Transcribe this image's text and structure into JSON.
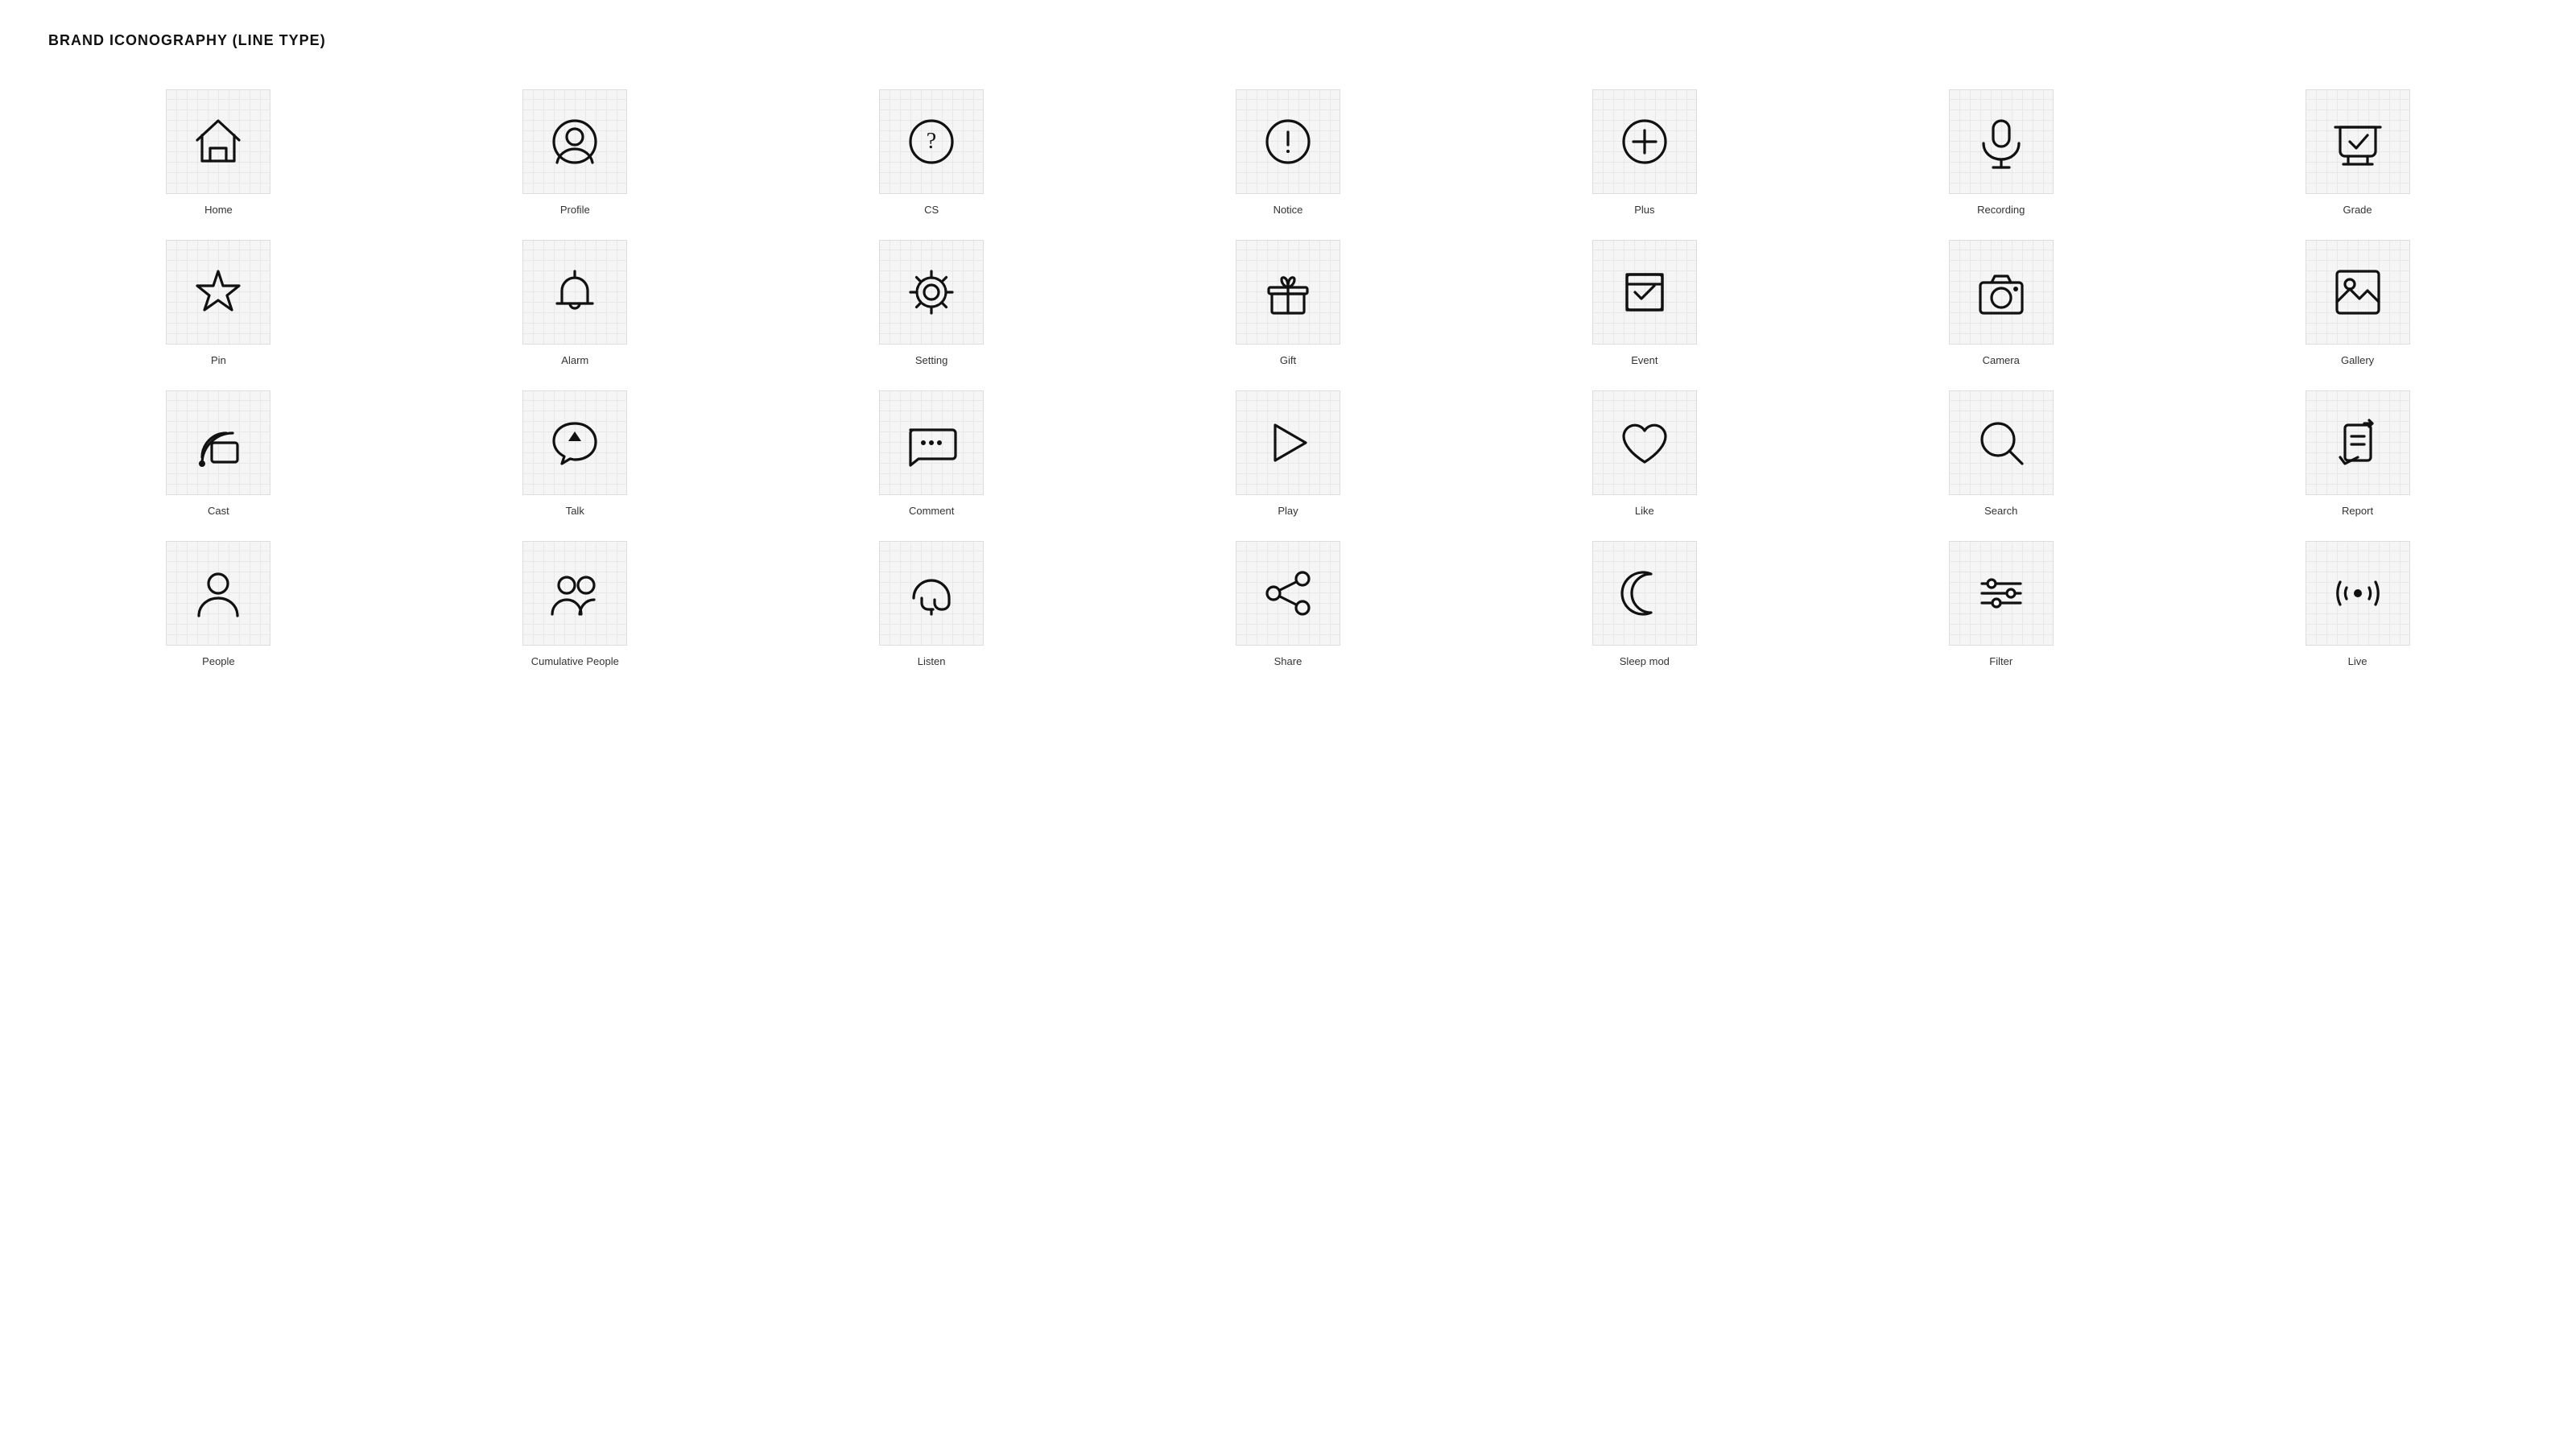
{
  "page": {
    "title": "BRAND ICONOGRAPHY (LINE TYPE)"
  },
  "icons": [
    {
      "id": "home",
      "label": "Home"
    },
    {
      "id": "profile",
      "label": "Profile"
    },
    {
      "id": "cs",
      "label": "CS"
    },
    {
      "id": "notice",
      "label": "Notice"
    },
    {
      "id": "plus",
      "label": "Plus"
    },
    {
      "id": "recording",
      "label": "Recording"
    },
    {
      "id": "grade",
      "label": "Grade"
    },
    {
      "id": "pin",
      "label": "Pin"
    },
    {
      "id": "alarm",
      "label": "Alarm"
    },
    {
      "id": "setting",
      "label": "Setting"
    },
    {
      "id": "gift",
      "label": "Gift"
    },
    {
      "id": "event",
      "label": "Event"
    },
    {
      "id": "camera",
      "label": "Camera"
    },
    {
      "id": "gallery",
      "label": "Gallery"
    },
    {
      "id": "cast",
      "label": "Cast"
    },
    {
      "id": "talk",
      "label": "Talk"
    },
    {
      "id": "comment",
      "label": "Comment"
    },
    {
      "id": "play",
      "label": "Play"
    },
    {
      "id": "like",
      "label": "Like"
    },
    {
      "id": "search",
      "label": "Search"
    },
    {
      "id": "report",
      "label": "Report"
    },
    {
      "id": "people",
      "label": "People"
    },
    {
      "id": "cumulative-people",
      "label": "Cumulative People"
    },
    {
      "id": "listen",
      "label": "Listen"
    },
    {
      "id": "share",
      "label": "Share"
    },
    {
      "id": "sleep-mod",
      "label": "Sleep mod"
    },
    {
      "id": "filter",
      "label": "Filter"
    },
    {
      "id": "live",
      "label": "Live"
    }
  ]
}
